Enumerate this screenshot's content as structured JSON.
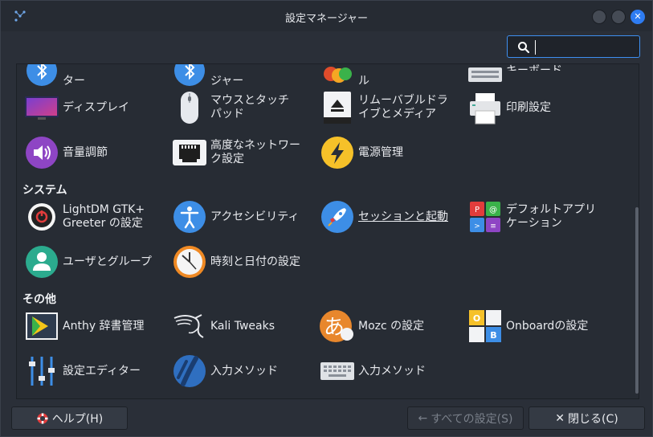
{
  "window": {
    "title": "設定マネージャー"
  },
  "search": {
    "value": "",
    "placeholder": ""
  },
  "partial_row": [
    "ター",
    "ジャー",
    "ル",
    "キーボード"
  ],
  "hardware": [
    {
      "label": "ディスプレイ",
      "icon": "display-icon"
    },
    {
      "label": "マウスとタッチ\nパッド",
      "icon": "mouse-icon"
    },
    {
      "label": "リムーバブルドラ\nイブとメディア",
      "icon": "eject-icon"
    },
    {
      "label": "印刷設定",
      "icon": "printer-icon"
    },
    {
      "label": "音量調節",
      "icon": "volume-icon"
    },
    {
      "label": "高度なネットワー\nク設定",
      "icon": "network-icon"
    },
    {
      "label": "電源管理",
      "icon": "power-icon"
    }
  ],
  "categories": {
    "system": "システム",
    "other": "その他"
  },
  "system": [
    {
      "label": "LightDM GTK+\nGreeter の設定",
      "icon": "lightdm-icon"
    },
    {
      "label": "アクセシビリティ",
      "icon": "accessibility-icon"
    },
    {
      "label": "セッションと起動",
      "icon": "rocket-icon"
    },
    {
      "label": "デフォルトアプリ\nケーション",
      "icon": "default-apps-icon"
    },
    {
      "label": "ユーザとグループ",
      "icon": "users-icon"
    },
    {
      "label": "時刻と日付の設定",
      "icon": "clock-icon"
    }
  ],
  "other": [
    {
      "label": "Anthy 辞書管理",
      "icon": "anthy-icon"
    },
    {
      "label": "Kali Tweaks",
      "icon": "kali-dragon-icon"
    },
    {
      "label": "Mozc の設定",
      "icon": "mozc-icon"
    },
    {
      "label": "Onboardの設定",
      "icon": "onboard-icon"
    },
    {
      "label": "設定エディター",
      "icon": "sliders-icon"
    },
    {
      "label": "入力メソッド",
      "icon": "input-method-icon"
    },
    {
      "label": "入力メソッド",
      "icon": "keyboard-icon"
    }
  ],
  "buttons": {
    "help": "ヘルプ(H)",
    "all_settings": "すべての設定(S)",
    "close": "閉じる(C)"
  }
}
